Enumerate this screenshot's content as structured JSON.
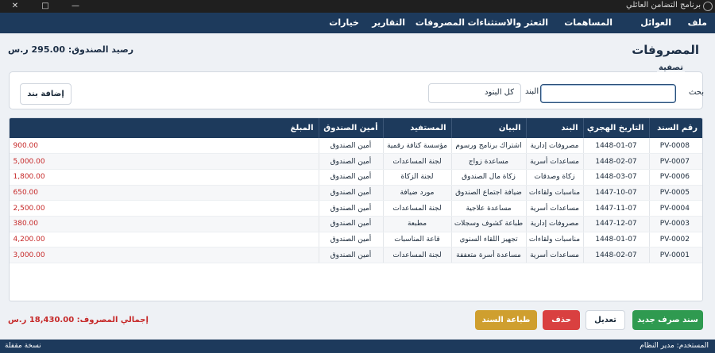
{
  "window": {
    "title": "برنامج التضامن العائلي",
    "controls": [
      "—",
      "□",
      "✕"
    ]
  },
  "menu": [
    {
      "label": "ملف"
    },
    {
      "label": "العوائل"
    },
    {
      "label": "المساهمات"
    },
    {
      "label": "التعثر والاستثناءات"
    },
    {
      "label": "المصروفات"
    },
    {
      "label": "التقارير"
    },
    {
      "label": "خيارات"
    }
  ],
  "page": {
    "title": "المصروفات",
    "balance": "رصيد الصندوق: 295.00 ر.س"
  },
  "filter": {
    "legend": "تصفية",
    "search_label": "بحث",
    "search_value": "",
    "item_label": "البند",
    "item_selected": "كل البنود",
    "add_item_label": "إضافة بند"
  },
  "table": {
    "columns": [
      "رقم السند",
      "التاريخ الهجري",
      "البند",
      "البيان",
      "المستفيد",
      "أمين الصندوق",
      "المبلغ"
    ],
    "rows": [
      {
        "voucher": "PV-0008",
        "date": "1448-01-07",
        "item": "مصروفات إدارية",
        "description": "اشتراك برنامج ورسوم",
        "beneficiary": "مؤسسة كتافة رقمية",
        "treasurer": "أمين الصندوق",
        "amount": "900.00"
      },
      {
        "voucher": "PV-0007",
        "date": "1448-02-07",
        "item": "مساعدات أسرية",
        "description": "مساعدة زواج",
        "beneficiary": "لجنة المساعدات",
        "treasurer": "أمين الصندوق",
        "amount": "5,000.00"
      },
      {
        "voucher": "PV-0006",
        "date": "1448-03-07",
        "item": "زكاة وصدقات",
        "description": "زكاة مال الصندوق",
        "beneficiary": "لجنة الزكاة",
        "treasurer": "أمين الصندوق",
        "amount": "1,800.00"
      },
      {
        "voucher": "PV-0005",
        "date": "1447-10-07",
        "item": "مناسبات ولقاءات",
        "description": "ضيافة اجتماع الصندوق",
        "beneficiary": "مورد ضيافة",
        "treasurer": "أمين الصندوق",
        "amount": "650.00"
      },
      {
        "voucher": "PV-0004",
        "date": "1447-11-07",
        "item": "مساعدات أسرية",
        "description": "مساعدة علاجية",
        "beneficiary": "لجنة المساعدات",
        "treasurer": "أمين الصندوق",
        "amount": "2,500.00"
      },
      {
        "voucher": "PV-0003",
        "date": "1447-12-07",
        "item": "مصروفات إدارية",
        "description": "طباعة كشوف وسجلات",
        "beneficiary": "مطبعة",
        "treasurer": "أمين الصندوق",
        "amount": "380.00"
      },
      {
        "voucher": "PV-0002",
        "date": "1448-01-07",
        "item": "مناسبات ولقاءات",
        "description": "تجهيز اللقاء السنوي",
        "beneficiary": "قاعة المناسبات",
        "treasurer": "أمين الصندوق",
        "amount": "4,200.00"
      },
      {
        "voucher": "PV-0001",
        "date": "1448-02-07",
        "item": "مساعدات أسرية",
        "description": "مساعدة أسرة متعففة",
        "beneficiary": "لجنة المساعدات",
        "treasurer": "أمين الصندوق",
        "amount": "3,000.00"
      }
    ]
  },
  "actions": {
    "new_label": "سند صرف جديد",
    "edit_label": "تعديل",
    "delete_label": "حذف",
    "print_label": "طباعة السند"
  },
  "total": "إجمالي المصروف: 18,430.00 ر.س",
  "status": {
    "user": "المستخدم: مدير النظام",
    "copy": "نسخة مقفلة"
  },
  "colors": {
    "navy": "#1d3a5c",
    "amount_red": "#c62828",
    "new_green": "#2f9a50",
    "delete_red": "#d94040",
    "print_gold": "#cf9f2f"
  }
}
